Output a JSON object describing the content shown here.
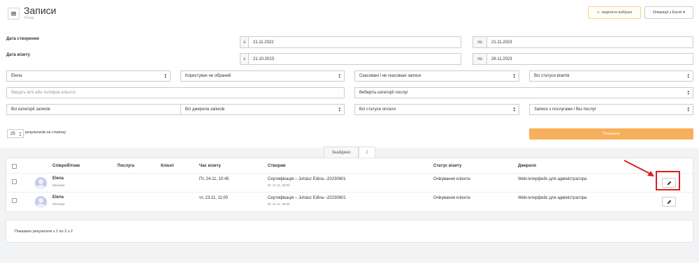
{
  "header": {
    "title": "Записи",
    "subtitle": "Огляд",
    "deselect_label": "виділити вибрані",
    "export_label": "Операції з Excel",
    "menu_icon": "hamburger-icon"
  },
  "filters": {
    "created_label": "Дата створення",
    "visit_label": "Дата візиту",
    "from_prefix": "з",
    "to_prefix": "по",
    "created_from": "21.11.2022",
    "created_to": "21.11.2023",
    "visit_from": "21.10.2023",
    "visit_to": "26.11.2023",
    "employee": "Elena",
    "user": "Користувач не обраний",
    "cancelled": "Скасовані і не скасовані записи",
    "visit_statuses": "Всі статуси візитів",
    "client_placeholder": "Введіть ім'я або телефон клієнта",
    "service_categories": "Виберіть категорії послуг",
    "record_categories": "Всі категорії записів",
    "record_sources": "Всі джерела записів",
    "payment_statuses": "Всі статуси оплати",
    "services_filter": "Записи з послугами і без послуг"
  },
  "paging": {
    "per_page": "25",
    "per_page_label": "результатів на сторінці",
    "show_button": "Показати"
  },
  "tabs": {
    "found_label": "Знайдено",
    "found_count": "2"
  },
  "table": {
    "headers": {
      "employee": "Співробітник",
      "service": "Послуга",
      "client": "Клієнт",
      "visit_time": "Час візиту",
      "created": "Створив",
      "visit_status": "Статус візиту",
      "source": "Джерело"
    },
    "rows": [
      {
        "name": "Elena",
        "role": "Манікюр",
        "visit_time": "Пт, 24.11, 10:45",
        "created_by": "Сертифікація – Juhász Edina –20230601",
        "created_date": "Вт, 21.11, 09:05",
        "status": "Очікування клієнта",
        "source": "Web-інтерфейс для адміністратора"
      },
      {
        "name": "Elena",
        "role": "Манікюр",
        "visit_time": "чт, 23.11, 11:00",
        "created_by": "Сертифікація – Juhász Edina –20230601",
        "created_date": "Вт, 21.11, 09:05",
        "status": "Очікування клієнта",
        "source": "Web-інтерфейс для адміністратора"
      }
    ]
  },
  "footer": {
    "results_text": "Показано результати з 1 по 2 з 2"
  },
  "colors": {
    "accent": "#f7b05b",
    "highlight": "#d9201e",
    "count": "#e5711e"
  }
}
